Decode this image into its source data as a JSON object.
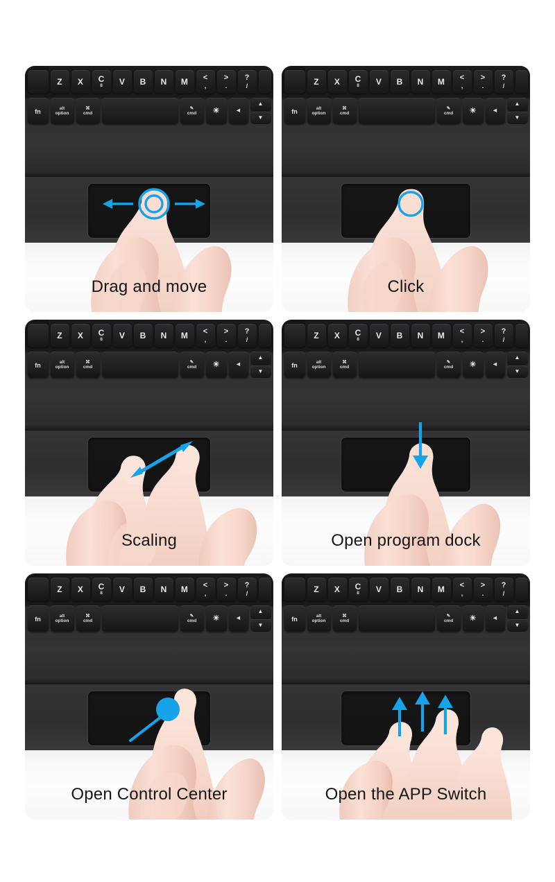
{
  "meta": {
    "background_color": "#ffffff",
    "accent_blue": "#17a3e8",
    "caption_color": "#161616"
  },
  "keyboard": {
    "row1": [
      {
        "main": "Z"
      },
      {
        "main": "X"
      },
      {
        "main": "C",
        "sub": "8"
      },
      {
        "main": "V"
      },
      {
        "main": "B"
      },
      {
        "main": "N"
      },
      {
        "main": "M"
      },
      {
        "top": "<",
        "bot": ","
      },
      {
        "top": ">",
        "bot": "."
      },
      {
        "top": "?",
        "bot": "/"
      }
    ],
    "row2": [
      {
        "name": "fn-key",
        "bot": "fn"
      },
      {
        "name": "alt-option-key",
        "top": "alt",
        "bot": "option"
      },
      {
        "name": "cmd-left-key",
        "top": "⌘",
        "bot": "cmd"
      },
      {
        "name": "space-key",
        "bot": ""
      },
      {
        "name": "cmd-right-key",
        "top": "✎",
        "bot": "cmd"
      },
      {
        "name": "brightness-key",
        "top": "☀"
      },
      {
        "name": "back-arrow-key",
        "top": "◀"
      },
      {
        "name": "up-down-key",
        "up": "▲",
        "down": "▼"
      }
    ]
  },
  "panels": [
    {
      "id": "drag-and-move",
      "caption": "Drag and move",
      "gesture": "double-circle-with-left-right-arrows",
      "fingers": 1
    },
    {
      "id": "click",
      "caption": "Click",
      "gesture": "single-circle-tap",
      "fingers": 1
    },
    {
      "id": "scaling",
      "caption": "Scaling",
      "gesture": "diagonal-double-headed-arrow",
      "fingers": 2
    },
    {
      "id": "open-program-dock",
      "caption": "Open program dock",
      "gesture": "single-down-arrow",
      "fingers": 1
    },
    {
      "id": "open-control-center",
      "caption": "Open Control Center",
      "gesture": "filled-dot-with-diagonal-tail",
      "fingers": 1
    },
    {
      "id": "open-the-app-switch",
      "caption": "Open the APP Switch",
      "gesture": "three-up-arrows",
      "fingers": 3
    }
  ]
}
